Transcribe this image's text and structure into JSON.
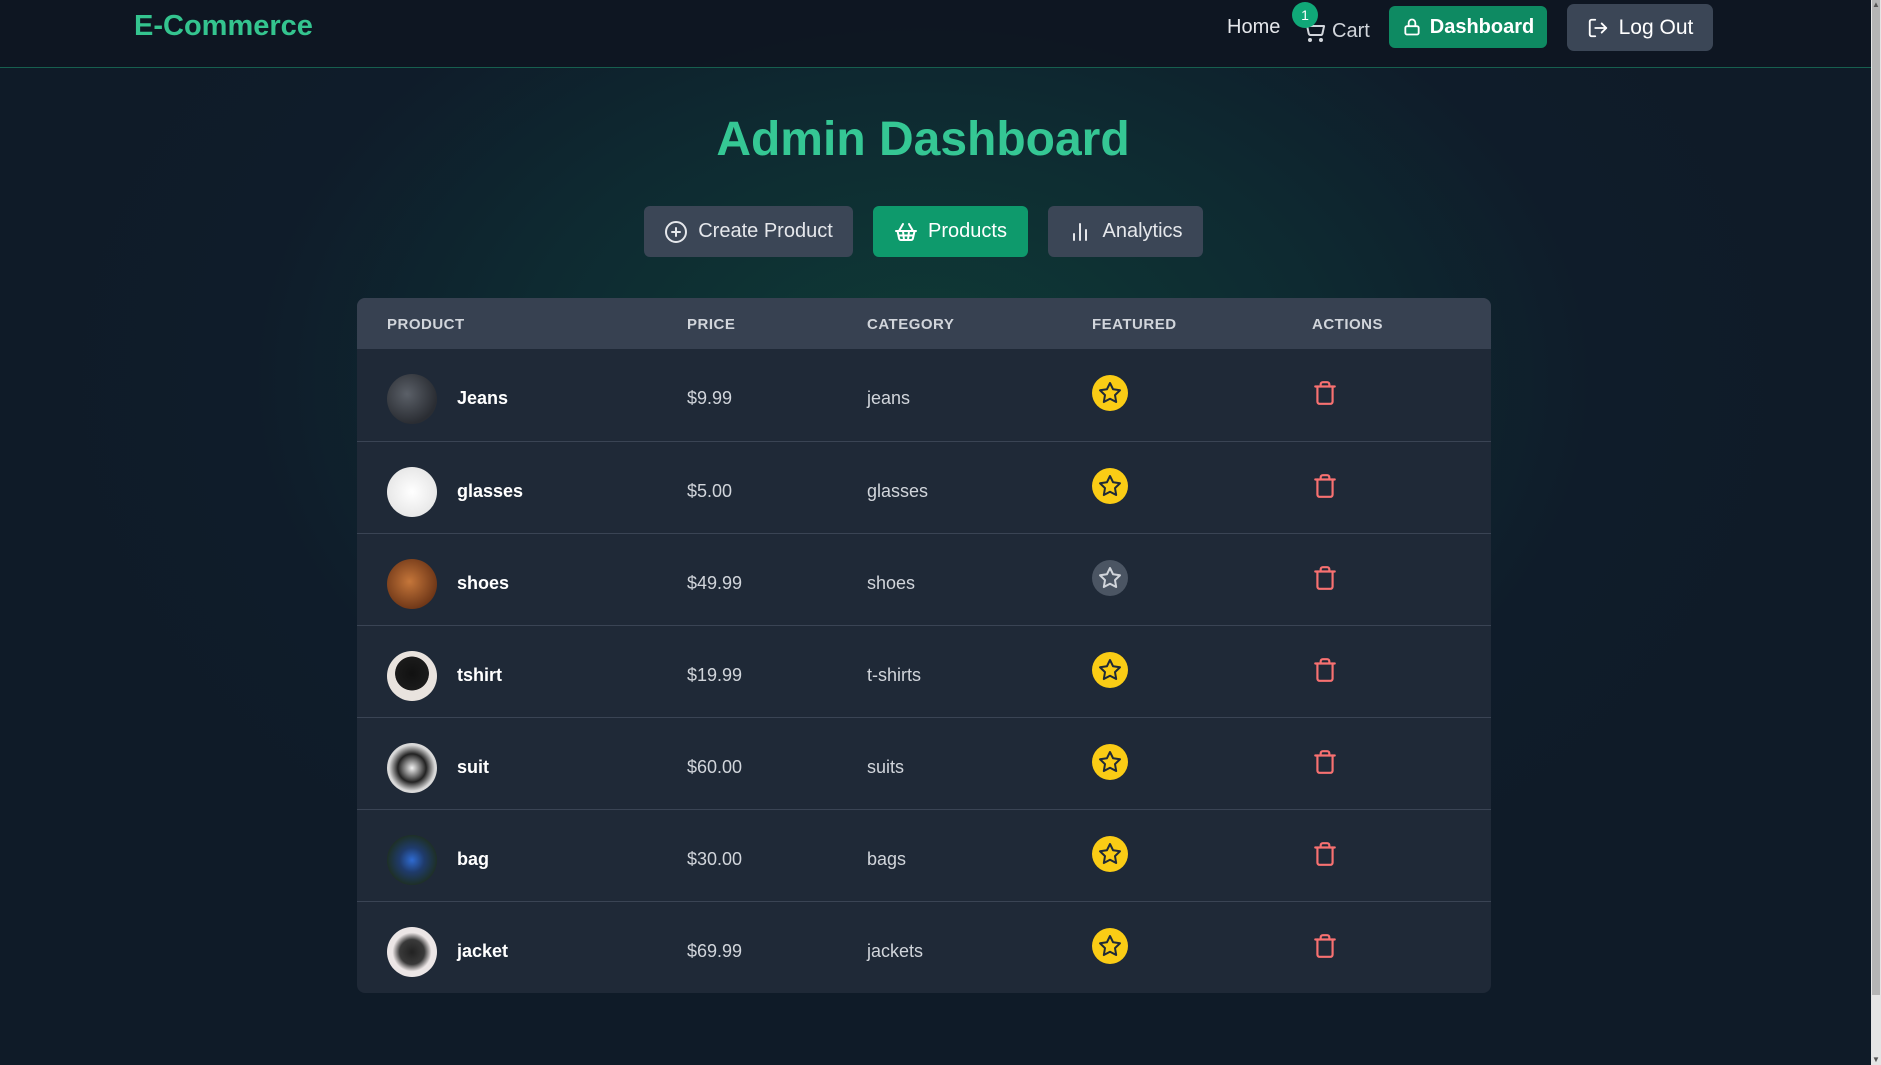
{
  "navbar": {
    "brand": "E-Commerce",
    "home_label": "Home",
    "cart_label": "Cart",
    "cart_count": "1",
    "dashboard_label": "Dashboard",
    "logout_label": "Log Out",
    "colors": {
      "brand": "#34c48f",
      "accent": "#0e8a62"
    }
  },
  "main": {
    "title": "Admin Dashboard",
    "tabs": [
      {
        "label": "Create Product",
        "icon": "plus-circle-icon",
        "active": false
      },
      {
        "label": "Products",
        "icon": "basket-icon",
        "active": true
      },
      {
        "label": "Analytics",
        "icon": "bar-chart-icon",
        "active": false
      }
    ]
  },
  "table": {
    "columns": [
      "PRODUCT",
      "PRICE",
      "CATEGORY",
      "FEATURED",
      "ACTIONS"
    ],
    "rows": [
      {
        "name": "Jeans",
        "price": "$9.99",
        "category": "jeans",
        "featured": true
      },
      {
        "name": "glasses",
        "price": "$5.00",
        "category": "glasses",
        "featured": true
      },
      {
        "name": "shoes",
        "price": "$49.99",
        "category": "shoes",
        "featured": false
      },
      {
        "name": "tshirt",
        "price": "$19.99",
        "category": "t-shirts",
        "featured": true
      },
      {
        "name": "suit",
        "price": "$60.00",
        "category": "suits",
        "featured": true
      },
      {
        "name": "bag",
        "price": "$30.00",
        "category": "bags",
        "featured": true
      },
      {
        "name": "jacket",
        "price": "$69.99",
        "category": "jackets",
        "featured": true
      }
    ],
    "colors": {
      "featured_on": "#facc15",
      "featured_off": "#4b5563",
      "delete": "#f87171"
    }
  }
}
